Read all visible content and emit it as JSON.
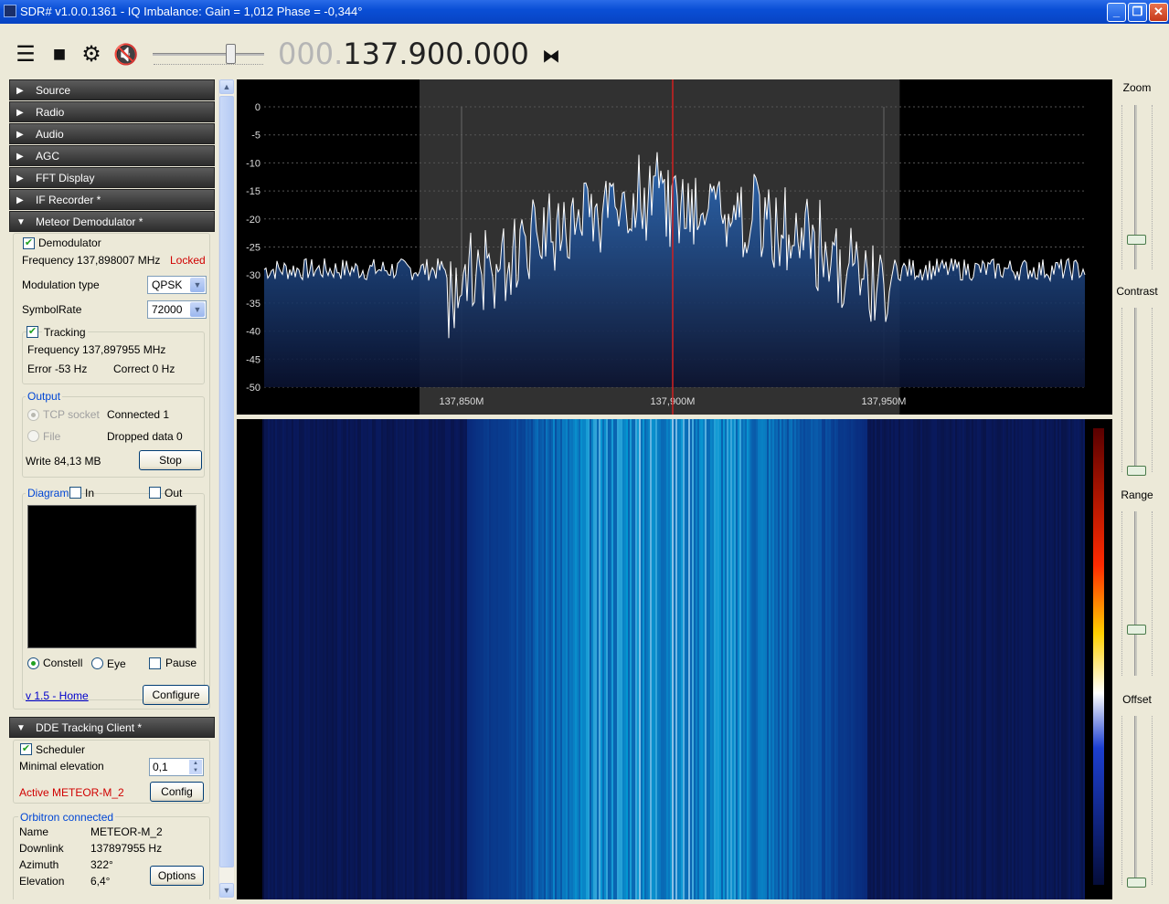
{
  "window": {
    "title": "SDR# v1.0.0.1361 - IQ Imbalance: Gain = 1,012 Phase = -0,344°"
  },
  "toolbar": {
    "menu_icon": "menu-icon",
    "stop_icon": "stop-icon",
    "settings_icon": "gear-icon",
    "mute_icon": "speaker-muted-icon",
    "skip_icon": "tune-skip-icon",
    "frequency_dim": "000.",
    "frequency_main": "137.900.000",
    "volume_level": 0.7
  },
  "sections": {
    "source": "Source",
    "radio": "Radio",
    "audio": "Audio",
    "agc": "AGC",
    "fft_display": "FFT Display",
    "if_recorder": "IF Recorder *",
    "meteor": "Meteor Demodulator *",
    "dde": "DDE Tracking Client *"
  },
  "meteor": {
    "demodulator_label": "Demodulator",
    "frequency_text": "Frequency 137,898007 MHz",
    "status": "Locked",
    "modulation_label": "Modulation type",
    "modulation_value": "QPSK",
    "symbolrate_label": "SymbolRate",
    "symbolrate_value": "72000",
    "tracking_label": "Tracking",
    "tracking_frequency": "Frequency 137,897955 MHz",
    "error": "Error -53 Hz",
    "correct": "Correct 0 Hz",
    "output_label": "Output",
    "tcp_label": "TCP socket",
    "connected": "Connected 1",
    "file_label": "File",
    "dropped": "Dropped data 0",
    "write": "Write 84,13 MB",
    "stop_button": "Stop",
    "diagram_label": "Diagram",
    "in_label": "In",
    "out_label": "Out",
    "constell_label": "Constell",
    "eye_label": "Eye",
    "pause_label": "Pause",
    "version_link": "v 1.5 - Home",
    "configure_button": "Configure"
  },
  "dde": {
    "scheduler_label": "Scheduler",
    "min_elev_label": "Minimal elevation",
    "min_elev_value": "0,1",
    "active_text": "Active METEOR-M_2",
    "config_button": "Config",
    "orbitron_label": "Orbitron connected",
    "name_label": "Name",
    "name_value": "METEOR-M_2",
    "downlink_label": "Downlink",
    "downlink_value": "137897955 Hz",
    "azimuth_label": "Azimuth",
    "azimuth_value": "322°",
    "elevation_label": "Elevation",
    "elevation_value": "6,4°",
    "options_button": "Options"
  },
  "right_panel": {
    "zoom_label": "Zoom",
    "contrast_label": "Contrast",
    "range_label": "Range",
    "offset_label": "Offset"
  },
  "colors": {
    "spectrum_fill": "#2e6fc0",
    "center_line": "#d02020",
    "waterfall_bg": "#050d3a",
    "locked": "#d00000"
  },
  "chart_data": {
    "type": "area",
    "ylabel": "",
    "xlabel": "",
    "y_ticks": [
      "0",
      "-5",
      "-10",
      "-15",
      "-20",
      "-25",
      "-30",
      "-35",
      "-40",
      "-45",
      "-50"
    ],
    "ylim": [
      -50,
      0
    ],
    "x_ticks": [
      "137,850M",
      "137,900M",
      "137,950M"
    ],
    "x_tick_values": [
      137.85,
      137.9,
      137.95
    ],
    "xlim": [
      137.84,
      138.0
    ],
    "center_frequency": 137.9,
    "filter_band": [
      137.84,
      137.96
    ],
    "noise_floor_db": -29,
    "signal_peak_db": -11,
    "signal_band": [
      137.855,
      137.945
    ]
  }
}
